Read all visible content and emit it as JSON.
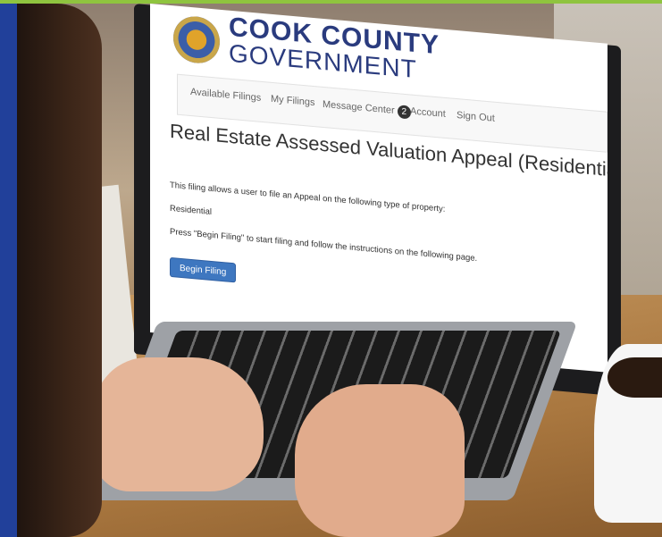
{
  "brand": {
    "line1": "COOK COUNTY",
    "line2": "GOVERNMENT"
  },
  "nav": {
    "items": [
      {
        "label": "Available Filings"
      },
      {
        "label": "My Filings"
      },
      {
        "label": "Message Center",
        "badge": "2"
      },
      {
        "label": "Account"
      },
      {
        "label": "Sign Out"
      }
    ]
  },
  "page": {
    "title": "Real Estate Assessed Valuation Appeal (Residential)",
    "intro": "This filing allows a user to file an Appeal on the following type of property:",
    "property_type": "Residential",
    "instructions": "Press \"Begin Filing\" to start filing and follow the instructions on the following page.",
    "begin_button": "Begin Filing"
  },
  "colors": {
    "accent_blue": "#21409a",
    "accent_green": "#8fc43f",
    "button_blue": "#3e77c0"
  }
}
